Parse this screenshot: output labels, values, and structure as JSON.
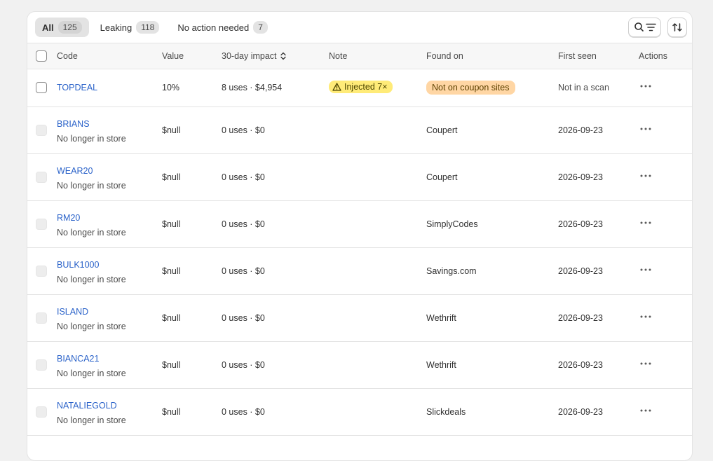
{
  "tabs": [
    {
      "label": "All",
      "count": "125"
    },
    {
      "label": "Leaking",
      "count": "118"
    },
    {
      "label": "No action needed",
      "count": "7"
    }
  ],
  "columns": {
    "code": "Code",
    "value": "Value",
    "impact": "30-day impact",
    "note": "Note",
    "found_on": "Found on",
    "first_seen": "First seen",
    "actions": "Actions"
  },
  "top_row": {
    "code": "TOPDEAL",
    "value": "10%",
    "impact": "8 uses · $4,954",
    "note": "Injected 7×",
    "found_on": "Not on coupon sites",
    "first_seen": "Not in a scan"
  },
  "rows": [
    {
      "code": "BRIANS",
      "status": "No longer in store",
      "value": "$null",
      "impact": "0 uses · $0",
      "found_on": "Coupert",
      "first_seen": "2026-09-23"
    },
    {
      "code": "WEAR20",
      "status": "No longer in store",
      "value": "$null",
      "impact": "0 uses · $0",
      "found_on": "Coupert",
      "first_seen": "2026-09-23"
    },
    {
      "code": "RM20",
      "status": "No longer in store",
      "value": "$null",
      "impact": "0 uses · $0",
      "found_on": "SimplyCodes",
      "first_seen": "2026-09-23"
    },
    {
      "code": "BULK1000",
      "status": "No longer in store",
      "value": "$null",
      "impact": "0 uses · $0",
      "found_on": "Savings.com",
      "first_seen": "2026-09-23"
    },
    {
      "code": "ISLAND",
      "status": "No longer in store",
      "value": "$null",
      "impact": "0 uses · $0",
      "found_on": "Wethrift",
      "first_seen": "2026-09-23"
    },
    {
      "code": "BIANCA21",
      "status": "No longer in store",
      "value": "$null",
      "impact": "0 uses · $0",
      "found_on": "Wethrift",
      "first_seen": "2026-09-23"
    },
    {
      "code": "NATALIEGOLD",
      "status": "No longer in store",
      "value": "$null",
      "impact": "0 uses · $0",
      "found_on": "Slickdeals",
      "first_seen": "2026-09-23"
    }
  ],
  "colors": {
    "link": "#2a62c9",
    "warning_badge": "#ffeb78",
    "attention_badge": "#ffd6a4",
    "card_bg": "#ffffff",
    "page_bg": "#f1f1f1"
  },
  "icons": {
    "search_filter": "search-filter-icon",
    "sort": "sort-icon",
    "warning": "warning-icon",
    "more": "more-horizontal-icon",
    "sort_toggle": "chevron-up-down-icon"
  }
}
